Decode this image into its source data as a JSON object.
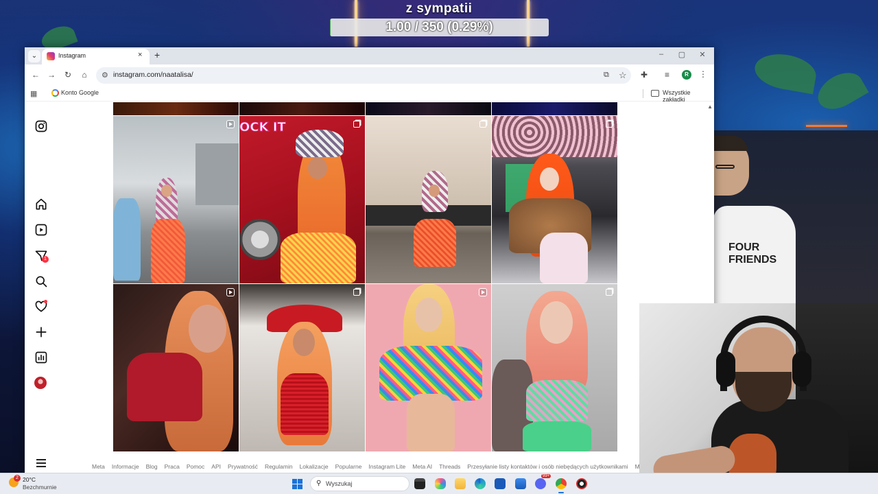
{
  "stream": {
    "title": "z sympatii",
    "progress_text": "1.00 / 350 (0.29%)",
    "progress_fraction": 0.0029
  },
  "streamer_shirt": "FOUR\nFRIENDS",
  "browser": {
    "tab_title": "Instagram",
    "tab_close": "×",
    "new_tab": "+",
    "url": "instagram.com/naatalisa/",
    "bookmarks": {
      "google_label": "Konto Google",
      "all_bookmarks_label": "Wszystkie zakładki"
    },
    "profile_initial": "R",
    "window_controls": [
      "–",
      "▢",
      "✕"
    ]
  },
  "instagram": {
    "sidebar": [
      {
        "name": "instagram-logo-icon"
      },
      {
        "name": "home-icon"
      },
      {
        "name": "reels-icon"
      },
      {
        "name": "messages-icon",
        "badge": "1"
      },
      {
        "name": "search-icon"
      },
      {
        "name": "notifications-heart-icon"
      },
      {
        "name": "create-icon"
      },
      {
        "name": "dashboard-icon"
      },
      {
        "name": "profile-avatar"
      }
    ],
    "posts": [
      {
        "type": "reel"
      },
      {
        "type": "carousel",
        "overlay_text": "OCK IT"
      },
      {
        "type": "carousel"
      },
      {
        "type": "carousel"
      },
      {
        "type": "reel"
      },
      {
        "type": "carousel"
      },
      {
        "type": "reel"
      },
      {
        "type": "carousel"
      }
    ],
    "footer_links": [
      "Meta",
      "Informacje",
      "Blog",
      "Praca",
      "Pomoc",
      "API",
      "Prywatność",
      "Regulamin",
      "Lokalizacje",
      "Popularne",
      "Instagram Lite",
      "Meta AI",
      "Threads",
      "Przesyłanie listy kontaktów i osób niebędących użytkownikami",
      "Meta Verified"
    ]
  },
  "taskbar": {
    "weather_temp": "20°C",
    "weather_desc": "Bezchmurnie",
    "weather_badge": "2",
    "search_placeholder": "Wyszukaj",
    "pinned_badge": "99+"
  },
  "colors": {
    "instagram_badge": "#ff3040",
    "windows_accent": "#1a73d9",
    "profile_avatar": "#1a8c4a"
  }
}
